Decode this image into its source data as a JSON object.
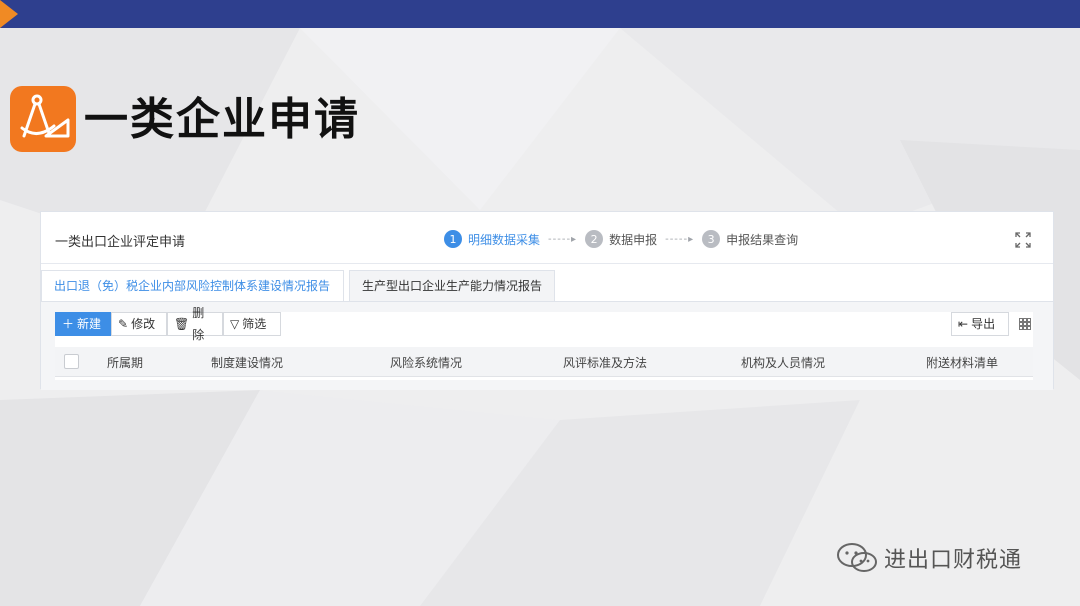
{
  "slide": {
    "title": "一类企业申请",
    "watermark": "进出口财税通"
  },
  "app": {
    "panel_title": "一类出口企业评定申请",
    "steps": [
      {
        "num": "1",
        "label": "明细数据采集",
        "active": true
      },
      {
        "num": "2",
        "label": "数据申报",
        "active": false
      },
      {
        "num": "3",
        "label": "申报结果查询",
        "active": false
      }
    ],
    "tabs": [
      {
        "label": "出口退（免）税企业内部风险控制体系建设情况报告",
        "active": true
      },
      {
        "label": "生产型出口企业生产能力情况报告",
        "active": false
      }
    ],
    "toolbar": {
      "new_label": "新建",
      "edit_label": "修改",
      "delete_label": "删除",
      "filter_label": "筛选",
      "export_label": "导出"
    },
    "table": {
      "columns": [
        "所属期",
        "制度建设情况",
        "风险系统情况",
        "风评标准及方法",
        "机构及人员情况",
        "附送材料清单"
      ]
    }
  },
  "colors": {
    "top_bar": "#2e3f8e",
    "accent_orange": "#f2781f",
    "accent_blue": "#3d8ee6"
  }
}
